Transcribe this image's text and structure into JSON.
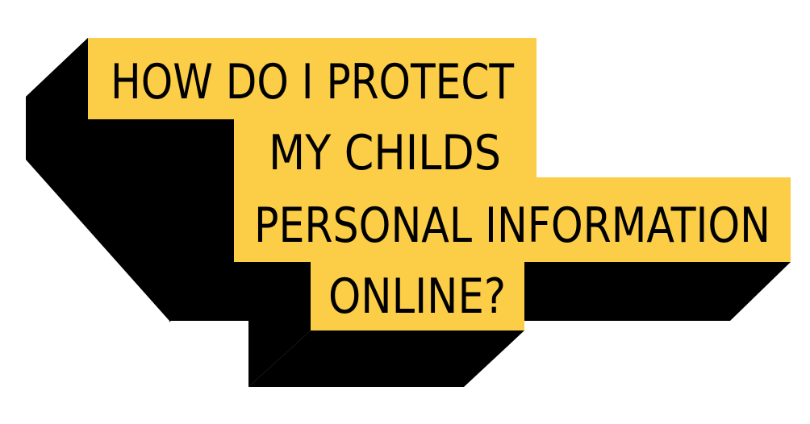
{
  "headline": {
    "line1": "HOW DO I PROTECT",
    "line2": "MY CHILDS",
    "line3": "PERSONAL INFORMATION",
    "line4": "ONLINE?"
  },
  "colors": {
    "panel": "#FCCD46",
    "shadow": "#000000",
    "text": "#000000",
    "background": "#FFFFFF"
  }
}
